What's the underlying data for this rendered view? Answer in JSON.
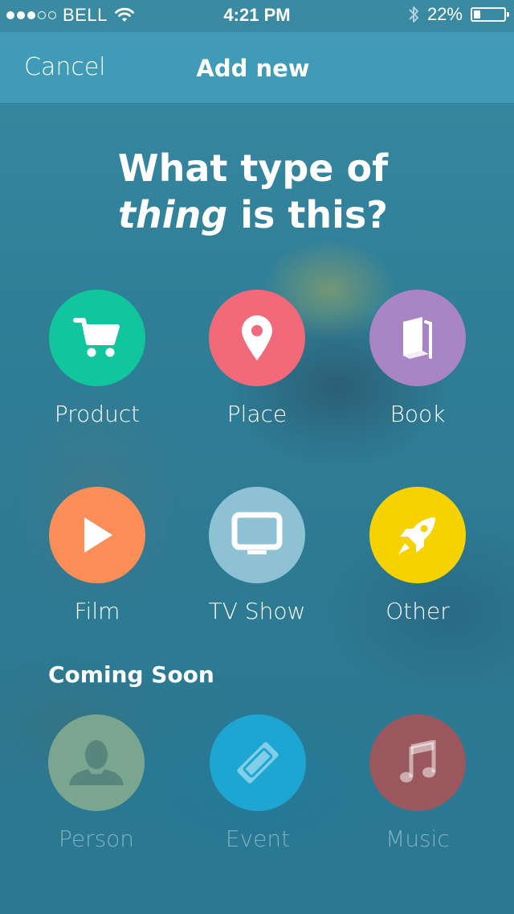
{
  "status_bar": {
    "carrier": "BELL",
    "time": "4:21 PM",
    "battery": "22%",
    "battery_level": 0.22
  },
  "nav": {
    "cancel_label": "Cancel",
    "title": "Add new"
  },
  "question": {
    "line1": "What type of",
    "emphasis": "thing",
    "line2_rest": " is this?"
  },
  "types": [
    {
      "label": "Product",
      "icon": "cart-icon",
      "color": "#11c69c"
    },
    {
      "label": "Place",
      "icon": "map-pin-icon",
      "color": "#f26a7a"
    },
    {
      "label": "Book",
      "icon": "book-icon",
      "color": "#a985c6"
    },
    {
      "label": "Film",
      "icon": "play-icon",
      "color": "#fb8e56"
    },
    {
      "label": "TV Show",
      "icon": "tv-icon",
      "color": "#8ec1d3"
    },
    {
      "label": "Other",
      "icon": "rocket-icon",
      "color": "#f5d200"
    }
  ],
  "coming_soon": {
    "title": "Coming Soon",
    "items": [
      {
        "label": "Person",
        "icon": "person-icon",
        "color": "#7aa58e"
      },
      {
        "label": "Event",
        "icon": "ticket-icon",
        "color": "#1ea6d3"
      },
      {
        "label": "Music",
        "icon": "music-note-icon",
        "color": "#9a575e"
      }
    ]
  }
}
